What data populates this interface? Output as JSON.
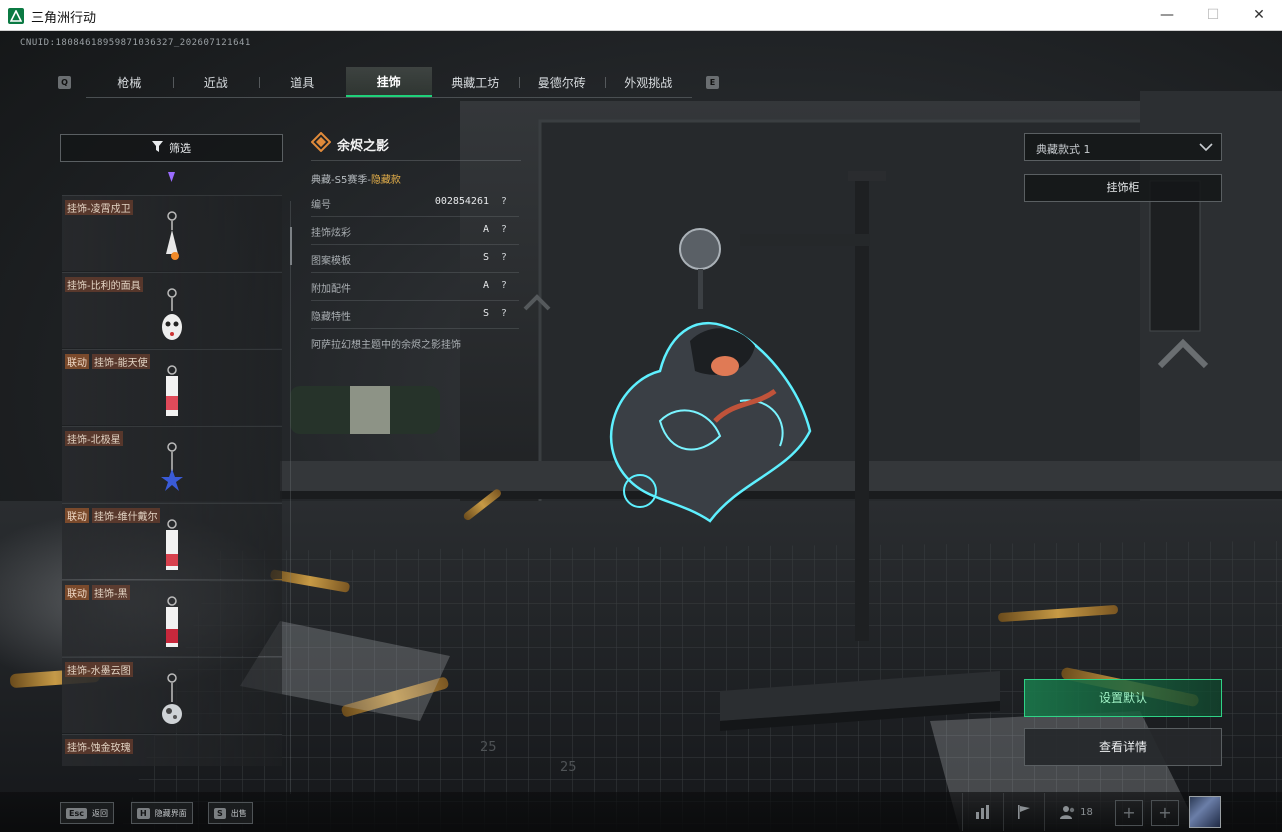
{
  "window": {
    "title": "三角洲行动",
    "min_glyph": "—",
    "max_glyph": "☐",
    "close_glyph": "✕"
  },
  "cnuid": "CNUID:18084618959871036327_202607121641",
  "tabs": {
    "prev_key": "Q",
    "next_key": "E",
    "items": [
      {
        "label": "枪械"
      },
      {
        "label": "近战"
      },
      {
        "label": "道具"
      },
      {
        "label": "挂饰",
        "active": true
      },
      {
        "label": "典藏工坊"
      },
      {
        "label": "曼德尔砖"
      },
      {
        "label": "外观挑战"
      }
    ]
  },
  "filter": {
    "label": "筛选"
  },
  "list": {
    "items": [
      {
        "tag": "",
        "name": "挂饰-凌霄戍卫",
        "thumb": "rocket-charm-icon"
      },
      {
        "tag": "",
        "name": "挂饰-比利的面具",
        "thumb": "mask-charm-icon"
      },
      {
        "tag": "联动",
        "name": "挂饰-能天使",
        "thumb": "card-charm-icon"
      },
      {
        "tag": "",
        "name": "挂饰-北极星",
        "thumb": "star-charm-icon"
      },
      {
        "tag": "联动",
        "name": "挂饰-维什戴尔",
        "thumb": "card-charm-icon"
      },
      {
        "tag": "联动",
        "name": "挂饰-黑",
        "thumb": "card-charm-icon"
      },
      {
        "tag": "",
        "name": "挂饰-水墨云图",
        "thumb": "orb-charm-icon"
      },
      {
        "tag": "",
        "name": "挂饰-蚀金玫瑰",
        "thumb": "rose-charm-icon"
      }
    ]
  },
  "info": {
    "title": "余烬之影",
    "season_prefix": "典藏-S5赛季-",
    "season_tag": "隐藏款",
    "attributes": [
      {
        "name": "编号",
        "value": "002854261"
      },
      {
        "name": "挂饰炫彩",
        "value": "A"
      },
      {
        "name": "图案模板",
        "value": "S"
      },
      {
        "name": "附加配件",
        "value": "A"
      },
      {
        "name": "隐藏特性",
        "value": "S"
      }
    ],
    "help_glyph": "?",
    "description": "阿萨拉幻想主题中的余烬之影挂饰"
  },
  "right": {
    "style_select_value": "典藏款式 1",
    "cabinet_label": "挂饰柜",
    "set_default_label": "设置默认",
    "details_label": "查看详情"
  },
  "bottom": {
    "hints": [
      {
        "key": "Esc",
        "label": "返回"
      },
      {
        "key": "H",
        "label": "隐藏界面"
      },
      {
        "key": "S",
        "label": "出售"
      }
    ],
    "friends_count": "18",
    "plus_glyph": "+"
  },
  "colors": {
    "accent_green": "#1fd17a",
    "hidden_tag": "#e5b04a",
    "collab_tag": "#7a4a2c"
  }
}
